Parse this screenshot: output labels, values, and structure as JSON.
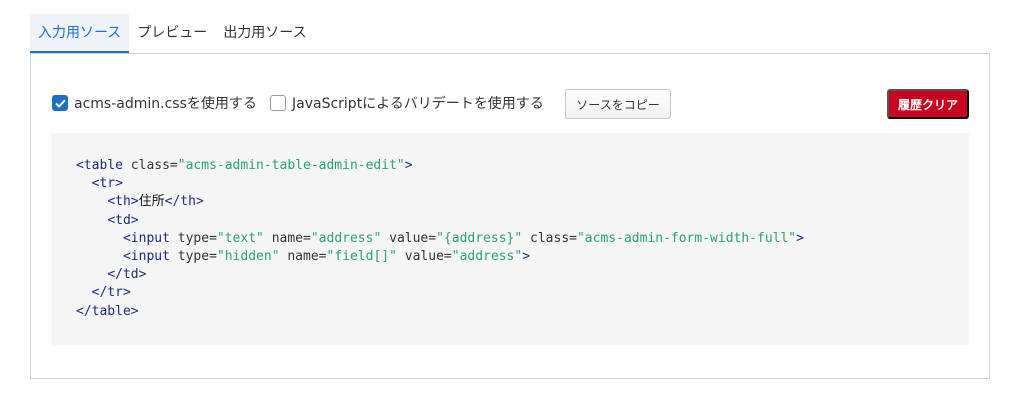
{
  "tabs": [
    {
      "label": "入力用ソース",
      "active": true
    },
    {
      "label": "プレビュー",
      "active": false
    },
    {
      "label": "出力用ソース",
      "active": false
    }
  ],
  "toolbar": {
    "use_admin_css": {
      "label": "acms-admin.cssを使用する",
      "checked": true
    },
    "use_js_validate": {
      "label": "JavaScriptによるバリデートを使用する",
      "checked": false
    },
    "copy_label": "ソースをコピー",
    "clear_label": "履歴クリア"
  },
  "code": {
    "lines": [
      {
        "indent": "",
        "parts": [
          [
            "tag",
            "<table "
          ],
          [
            "attr",
            "class="
          ],
          [
            "val",
            "\"acms-admin-table-admin-edit\""
          ],
          [
            "tag",
            ">"
          ]
        ]
      },
      {
        "indent": "  ",
        "parts": [
          [
            "tag",
            "<tr>"
          ]
        ]
      },
      {
        "indent": "    ",
        "parts": [
          [
            "tag",
            "<th>"
          ],
          [
            "txt",
            "住所"
          ],
          [
            "tag",
            "</th>"
          ]
        ]
      },
      {
        "indent": "    ",
        "parts": [
          [
            "tag",
            "<td>"
          ]
        ]
      },
      {
        "indent": "      ",
        "parts": [
          [
            "tag",
            "<input "
          ],
          [
            "attr",
            "type="
          ],
          [
            "val",
            "\"text\""
          ],
          [
            "attr",
            " name="
          ],
          [
            "val",
            "\"address\""
          ],
          [
            "attr",
            " value="
          ],
          [
            "val",
            "\"{address}\""
          ],
          [
            "attr",
            " class="
          ],
          [
            "val",
            "\"acms-admin-form-width-full\""
          ],
          [
            "tag",
            ">"
          ]
        ]
      },
      {
        "indent": "      ",
        "parts": [
          [
            "tag",
            "<input "
          ],
          [
            "attr",
            "type="
          ],
          [
            "val",
            "\"hidden\""
          ],
          [
            "attr",
            " name="
          ],
          [
            "val",
            "\"field[]\""
          ],
          [
            "attr",
            " value="
          ],
          [
            "val",
            "\"address\""
          ],
          [
            "tag",
            ">"
          ]
        ]
      },
      {
        "indent": "    ",
        "parts": [
          [
            "tag",
            "</td>"
          ]
        ]
      },
      {
        "indent": "  ",
        "parts": [
          [
            "tag",
            "</tr>"
          ]
        ]
      },
      {
        "indent": "",
        "parts": [
          [
            "tag",
            "</table>"
          ]
        ]
      }
    ]
  },
  "colors": {
    "accent": "#1e6fc6",
    "danger": "#c9061f",
    "code_tag": "#1f2a7a",
    "code_value": "#2aa07c"
  }
}
